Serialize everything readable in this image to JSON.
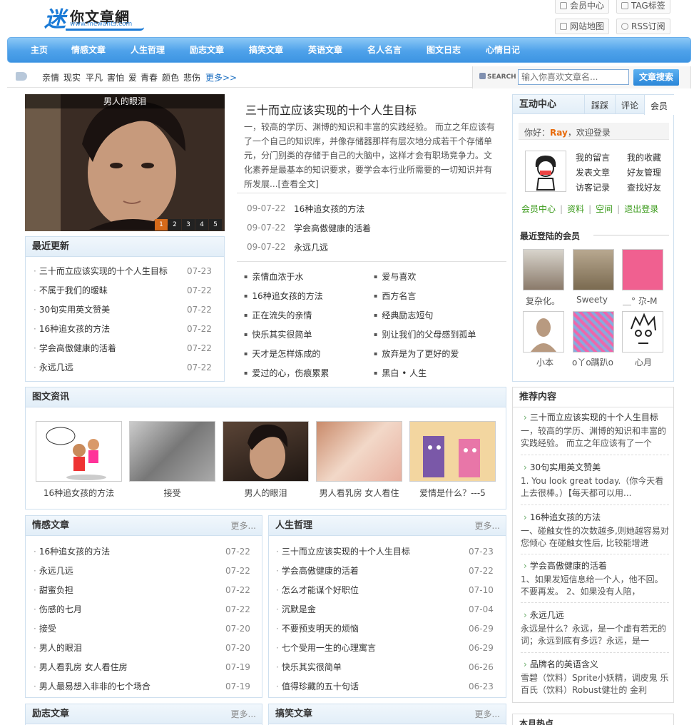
{
  "header": {
    "logo_char": "迷",
    "logo_text": "你文章網",
    "logo_url": "www.mewants.com",
    "links": [
      "会员中心",
      "TAG标签",
      "网站地图",
      "RSS订阅"
    ]
  },
  "nav": [
    "主页",
    "情感文章",
    "人生哲理",
    "励志文章",
    "搞笑文章",
    "英语文章",
    "名人名言",
    "图文日志",
    "心情日记"
  ],
  "tags": {
    "items": [
      "亲情",
      "现实",
      "平凡",
      "害怕",
      "爱",
      "青春",
      "颜色",
      "悲伤"
    ],
    "more": "更多>>"
  },
  "search": {
    "label": "SEARCH",
    "placeholder": "输入你喜欢文章名...",
    "button": "文章搜索"
  },
  "slideshow": {
    "caption": "男人的眼泪",
    "pages": [
      "1",
      "2",
      "3",
      "4",
      "5"
    ]
  },
  "featured": {
    "title": "三十而立应该实现的十个人生目标",
    "summary": "一，较高的学历、渊博的知识和丰富的实践经验。 而立之年应该有了一个自己的知识库，并像存储器那样有层次地分成若干个存储单元，分门别类的存储于自己的大脑中，这样才会有职场竞争力。文化素养是最基本的知识要求，要学会本行业所需要的一切知识并有所发展...",
    "read_all": "[查看全文]",
    "list": [
      {
        "date": "09-07-22",
        "title": "16种追女孩的方法"
      },
      {
        "date": "09-07-22",
        "title": "学会高傲健康的活着"
      },
      {
        "date": "09-07-22",
        "title": "永远几远"
      }
    ]
  },
  "bullets_left": [
    "亲情血浓于水",
    "16种追女孩的方法",
    "正在流失的亲情",
    "快乐其实很简单",
    "天才是怎样炼成的",
    "爱过的心，伤痕累累"
  ],
  "bullets_right": [
    "爱与喜欢",
    "西方名言",
    "经典励志短句",
    "别让我们的父母感到孤单",
    "放弃是为了更好的爱",
    "黑白 • 人生"
  ],
  "recent": {
    "title": "最近更新",
    "items": [
      {
        "title": "三十而立应该实现的十个人生目标",
        "date": "07-23"
      },
      {
        "title": "不属于我们的暧昧",
        "date": "07-22"
      },
      {
        "title": "30句实用英文赞美",
        "date": "07-22"
      },
      {
        "title": "16种追女孩的方法",
        "date": "07-22"
      },
      {
        "title": "学会高傲健康的活着",
        "date": "07-22"
      },
      {
        "title": "永远几远",
        "date": "07-22"
      }
    ]
  },
  "member": {
    "tabs": [
      "互动中心",
      "踩踩",
      "评论",
      "会员"
    ],
    "greeting_prefix": "你好：",
    "username": "Ray",
    "greeting_suffix": "，欢迎登录",
    "links": [
      "我的留言",
      "我的收藏",
      "发表文章",
      "好友管理",
      "访客记录",
      "查找好友"
    ],
    "bottom_links": [
      "会员中心",
      "资料",
      "空间",
      "退出登录"
    ],
    "recent_title": "最近登陆的会员",
    "users": [
      "复杂化。",
      "Sweety",
      "＿° 尕-M",
      "小本",
      "o丫o蹒趴o",
      "心月"
    ]
  },
  "photos": {
    "title": "图文资讯",
    "items": [
      "16种追女孩的方法",
      "接受",
      "男人的眼泪",
      "男人看乳房 女人看住",
      "爱情是什么？---5"
    ]
  },
  "recommend": {
    "title": "推荐内容",
    "items": [
      {
        "title": "三十而立应该实现的十个人生目标",
        "desc": "一，较高的学历、渊博的知识和丰富的实践经验。 而立之年应该有了一个"
      },
      {
        "title": "30句实用英文赞美",
        "desc": "1. You look great today.（你今天看上去很棒。）【每天都可以用..."
      },
      {
        "title": "16种追女孩的方法",
        "desc": "一、碰触女性的次数越多,则她越容易对您倾心 在碰触女性后, 比较能增进"
      },
      {
        "title": "学会高傲健康的活着",
        "desc": "1、如果发短信息给一个人，他不回。不要再发。 2、如果没有人陪，"
      },
      {
        "title": "永远几远",
        "desc": "永远是什么？永远，是一个虚有若无的词；永远到底有多远？永远，是一"
      },
      {
        "title": "品牌名的英语含义",
        "desc": "雪碧（饮料）Sprite小妖精，调皮鬼 乐百氏（饮料）Robust健壮的 金利"
      }
    ],
    "next_title": "本月热点"
  },
  "emotion": {
    "title": "情感文章",
    "more": "更多...",
    "items": [
      {
        "title": "16种追女孩的方法",
        "date": "07-22"
      },
      {
        "title": "永远几远",
        "date": "07-22"
      },
      {
        "title": "甜蜜负担",
        "date": "07-22"
      },
      {
        "title": "伤感的七月",
        "date": "07-22"
      },
      {
        "title": "接受",
        "date": "07-20"
      },
      {
        "title": "男人的眼泪",
        "date": "07-20"
      },
      {
        "title": "男人看乳房 女人看住房",
        "date": "07-19"
      },
      {
        "title": "男人最易想入非非的七个场合",
        "date": "07-19"
      }
    ]
  },
  "philosophy": {
    "title": "人生哲理",
    "more": "更多...",
    "items": [
      {
        "title": "三十而立应该实现的十个人生目标",
        "date": "07-23"
      },
      {
        "title": "学会高傲健康的活着",
        "date": "07-22"
      },
      {
        "title": "怎么才能谋个好职位",
        "date": "07-10"
      },
      {
        "title": "沉默是金",
        "date": "07-04"
      },
      {
        "title": "不要预支明天的烦恼",
        "date": "06-29"
      },
      {
        "title": "七个受用一生的心理寓言",
        "date": "06-29"
      },
      {
        "title": "快乐其实很简单",
        "date": "06-26"
      },
      {
        "title": "值得珍藏的五十句话",
        "date": "06-23"
      }
    ]
  },
  "inspire": {
    "title": "励志文章",
    "more": "更多..."
  },
  "funny": {
    "title": "搞笑文章",
    "more": "更多..."
  }
}
